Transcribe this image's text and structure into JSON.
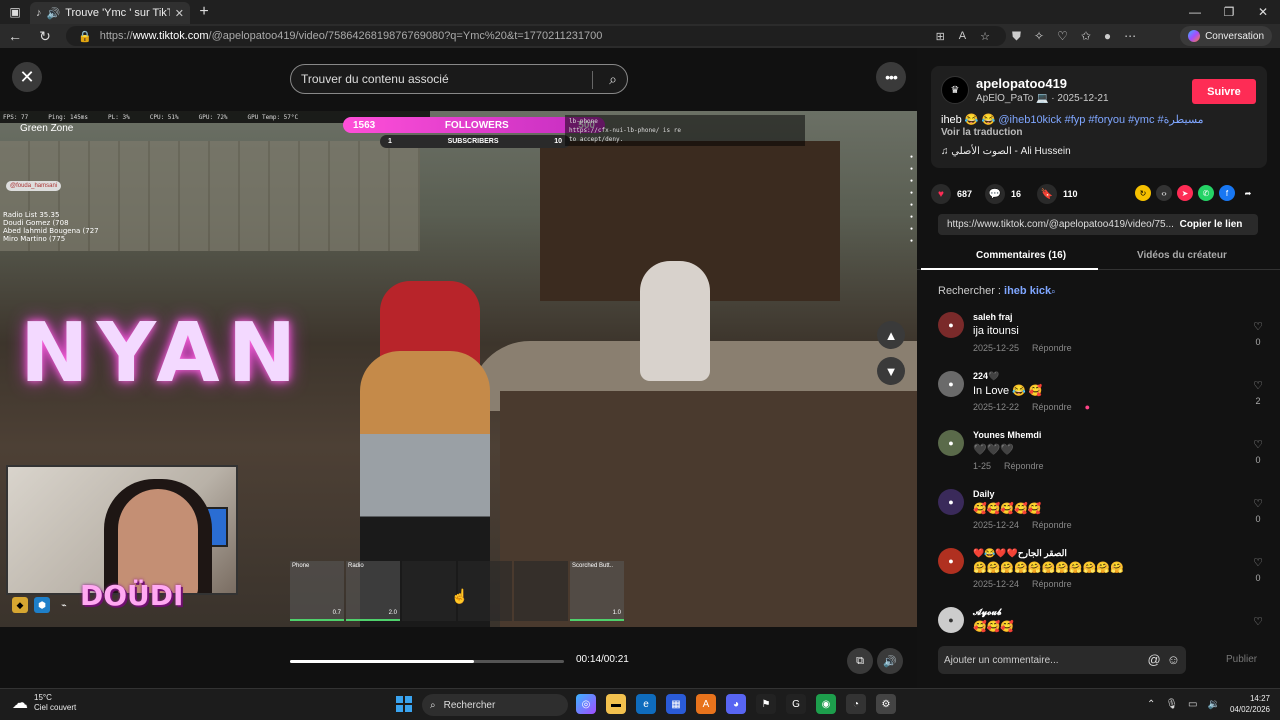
{
  "browser": {
    "tab_title": "Trouve 'Ymc ' sur TikTok | Re",
    "url_prefix": "https://",
    "url_host": "www.tiktok.com",
    "url_path": "/@apelopatoo419/video/7586426819876769080?q=Ymc%20&t=1770211231700",
    "conversation_label": "Conversation"
  },
  "page": {
    "search_placeholder": "Trouver du contenu associé",
    "time_display": "00:14/00:21",
    "progress_fraction": 0.67
  },
  "game_overlay": {
    "fps": "FPS: 77",
    "ping": "Ping: 145ms",
    "pl": "PL: 3%",
    "cpu": "CPU: 51%",
    "gpu": "GPU: 72%",
    "gpu_temp": "GPU Temp: 57°C",
    "zone": "Green Zone",
    "followers_left": "1563",
    "followers_label": "FOLLOWERS",
    "followers_right": "500",
    "subs_left": "1",
    "subs_label": "SUBSCRIBERS",
    "subs_right": "10",
    "code_line1": "lb-phone",
    "code_line2": "https://cfx-nui-lb-phone/ is re",
    "code_line3": "to accept/deny.",
    "tag": "@fouda_hamsani",
    "radio_title": "Radio List 35.35",
    "radio_1": "Doudi Gomez (708",
    "radio_2": "Abed lahmid Bougena (727",
    "radio_3": "Miro Martino (775",
    "streamer": "DOÜDI",
    "slot1_label": "Phone",
    "slot1_qty": "0.7",
    "slot2_label": "Radio",
    "slot2_qty": "2.0",
    "slot3_label": "Scorched Butt..",
    "slot3_qty": "1.0",
    "neon_text": "NYAN"
  },
  "author": {
    "username": "apelopatoo419",
    "display": "ApElO_PaTo",
    "date": "2025-12-21",
    "follow_label": "Suivre",
    "caption_start": "iheb",
    "caption_mention": "@iheb10kick",
    "caption_tags": "#fyp #foryou #ymc #مسيطرة",
    "translate": "Voir la traduction",
    "music": "الصوت الأصلي - Ali Hussein"
  },
  "stats": {
    "likes": "687",
    "comments": "16",
    "saves": "110"
  },
  "link": {
    "url": "https://www.tiktok.com/@apelopatoo419/video/75...",
    "copy_label": "Copier le lien"
  },
  "tabs": {
    "comments": "Commentaires (16)",
    "creator": "Vidéos du créateur"
  },
  "search_related": {
    "label": "Rechercher : ",
    "keyword": "iheb kick"
  },
  "comments": [
    {
      "name": "saleh fraj",
      "text": "ija itounsi",
      "date": "2025-12-25",
      "reply": "Répondre",
      "likes": "0"
    },
    {
      "name": "224🖤",
      "text": "In Love 😂 🥰",
      "date": "2025-12-22",
      "reply": "Répondre",
      "likes": "2"
    },
    {
      "name": "Younes Mhemdi",
      "text": "🖤🖤🖤",
      "date": "1-25",
      "reply": "Répondre",
      "likes": "0"
    },
    {
      "name": "Daily",
      "text": "🥰🥰🥰🥰🥰",
      "date": "2025-12-24",
      "reply": "Répondre",
      "likes": "0"
    },
    {
      "name": "❤️😂❤️❤️الصقر الجارح",
      "text": "🤗🤗🤗🤗🤗🤗🤗🤗🤗🤗🤗",
      "date": "2025-12-24",
      "reply": "Répondre",
      "likes": "0"
    },
    {
      "name": "𝓐𝔂𝓸𝓾𝓫",
      "text": "🥰🥰🥰",
      "date": "",
      "reply": "",
      "likes": ""
    }
  ],
  "comment_box": {
    "placeholder": "Ajouter un commentaire...",
    "publish": "Publier"
  },
  "taskbar": {
    "temp": "15°C",
    "weather": "Ciel couvert",
    "search": "Rechercher",
    "time": "14:27",
    "date": "04/02/2026"
  }
}
